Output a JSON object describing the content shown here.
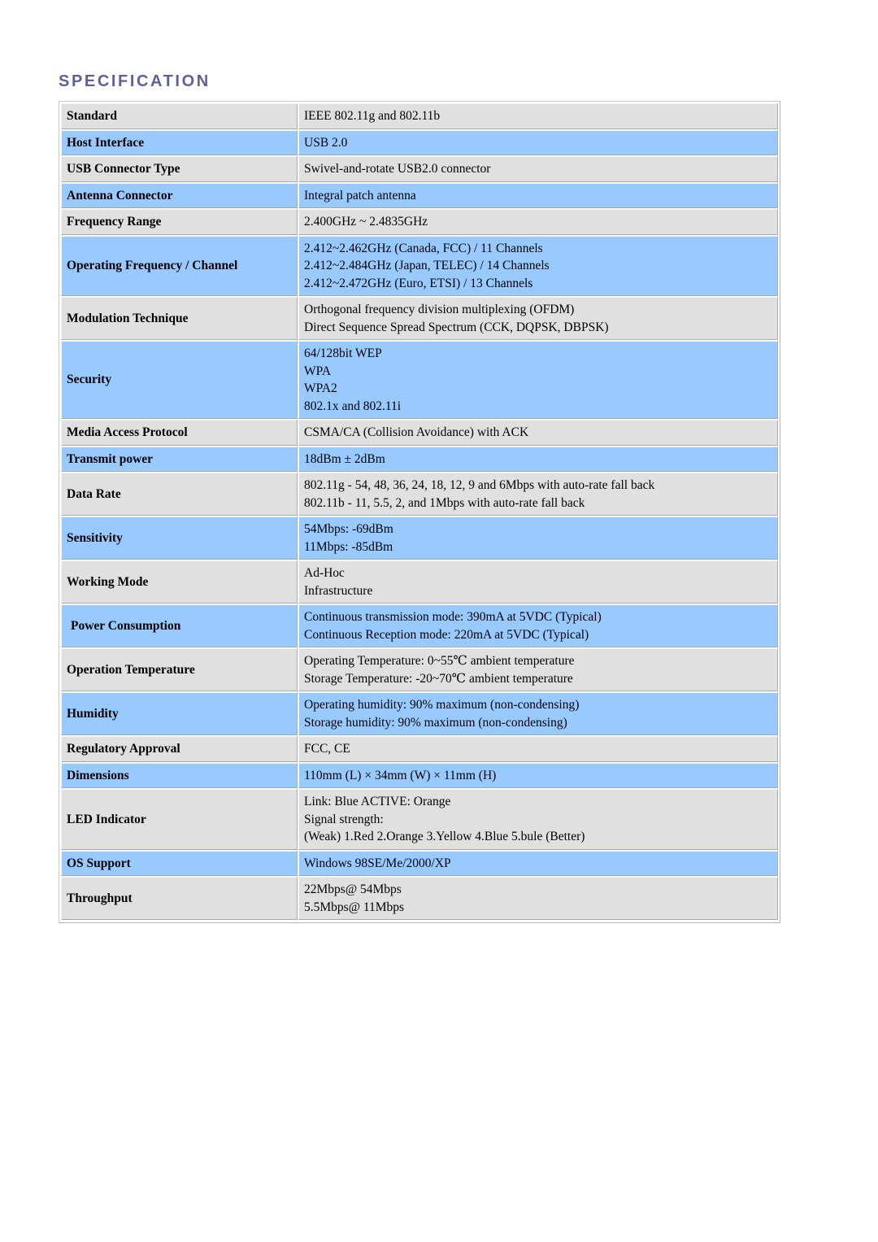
{
  "document": {
    "title": "SPECIFICATION",
    "title_color": "#5f5f9a",
    "row_fill_blue": "#98caff",
    "row_fill_gray": "#e0e0e0"
  },
  "spec_rows": [
    {
      "label": "Standard",
      "fill": "gray",
      "values": [
        "IEEE 802.11g and 802.11b"
      ]
    },
    {
      "label": "Host Interface",
      "fill": "blue",
      "values": [
        "USB 2.0"
      ]
    },
    {
      "label": "USB Connector Type",
      "fill": "gray",
      "values": [
        "Swivel-and-rotate USB2.0 connector"
      ]
    },
    {
      "label": "Antenna Connector",
      "fill": "blue",
      "values": [
        "Integral patch antenna"
      ]
    },
    {
      "label": "Frequency Range",
      "fill": "gray",
      "values": [
        "2.400GHz ~ 2.4835GHz"
      ]
    },
    {
      "label": "Operating Frequency / Channel",
      "fill": "blue",
      "values": [
        "2.412~2.462GHz (Canada, FCC) / 11 Channels",
        "2.412~2.484GHz (Japan, TELEC) / 14 Channels",
        "2.412~2.472GHz (Euro, ETSI) / 13 Channels"
      ]
    },
    {
      "label": "Modulation Technique",
      "fill": "gray",
      "values": [
        "Orthogonal frequency division multiplexing (OFDM)",
        "Direct Sequence Spread Spectrum (CCK, DQPSK, DBPSK)"
      ]
    },
    {
      "label": "Security",
      "fill": "blue",
      "values": [
        "64/128bit WEP",
        "WPA",
        "WPA2",
        "802.1x and 802.11i"
      ]
    },
    {
      "label": "Media Access Protocol",
      "fill": "gray",
      "values": [
        "CSMA/CA (Collision Avoidance) with ACK"
      ]
    },
    {
      "label": "Transmit power",
      "fill": "blue",
      "values": [
        "18dBm ± 2dBm"
      ]
    },
    {
      "label": "Data Rate",
      "fill": "gray",
      "values": [
        "802.11g - 54, 48, 36, 24, 18, 12, 9 and 6Mbps with auto-rate fall back",
        "802.11b - 11, 5.5, 2, and 1Mbps with auto-rate fall back"
      ]
    },
    {
      "label": "Sensitivity",
      "fill": "blue",
      "values": [
        "54Mbps: -69dBm",
        "11Mbps: -85dBm"
      ]
    },
    {
      "label": "Working Mode",
      "fill": "gray",
      "values": [
        "Ad-Hoc",
        "Infrastructure"
      ]
    },
    {
      "label": "Power Consumption",
      "fill": "blue",
      "label_indent": true,
      "values": [
        "Continuous transmission mode: 390mA at 5VDC (Typical)",
        "Continuous Reception mode: 220mA at 5VDC (Typical)"
      ]
    },
    {
      "label": "Operation Temperature",
      "fill": "gray",
      "values": [
        "Operating Temperature: 0~55℃ ambient temperature",
        "Storage Temperature: -20~70℃ ambient temperature"
      ]
    },
    {
      "label": "Humidity",
      "fill": "blue",
      "values": [
        "Operating humidity: 90% maximum (non-condensing)",
        "Storage humidity: 90% maximum (non-condensing)"
      ]
    },
    {
      "label": "Regulatory Approval",
      "fill": "gray",
      "values": [
        "FCC, CE"
      ]
    },
    {
      "label": "Dimensions",
      "fill": "blue",
      "values": [
        "110mm (L) × 34mm (W) × 11mm (H)"
      ]
    },
    {
      "label": "LED Indicator",
      "fill": "gray",
      "values": [
        "Link: Blue ACTIVE: Orange",
        "Signal strength:",
        "(Weak) 1.Red 2.Orange 3.Yellow 4.Blue 5.bule (Better)"
      ]
    },
    {
      "label": "OS Support",
      "fill": "blue",
      "values": [
        "Windows 98SE/Me/2000/XP"
      ]
    },
    {
      "label": "Throughput",
      "fill": "gray",
      "values": [
        "22Mbps@ 54Mbps",
        "5.5Mbps@ 11Mbps"
      ]
    }
  ]
}
